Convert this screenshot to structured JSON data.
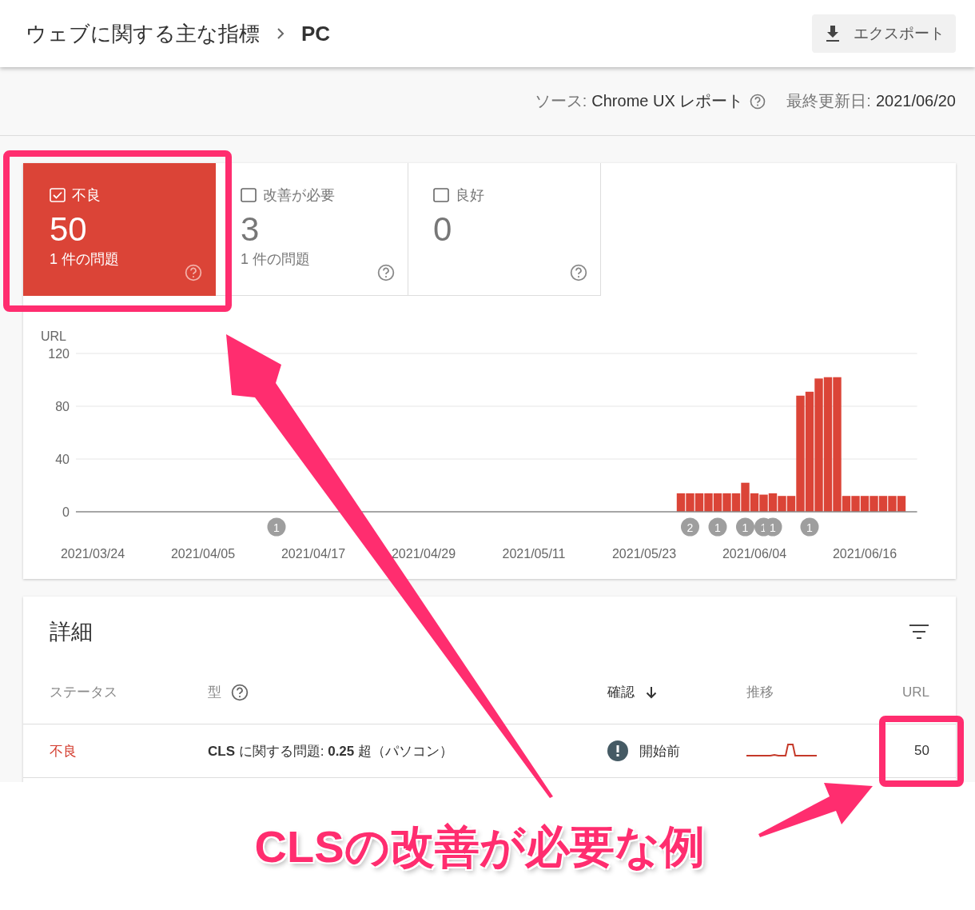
{
  "header": {
    "breadcrumb": [
      {
        "label": "ウェブに関する主な指標"
      },
      {
        "label": "PC"
      }
    ],
    "export_button": "エクスポート"
  },
  "info": {
    "source_label": "ソース:",
    "source": "Chrome UX レポート",
    "updated_label": "最終更新日:",
    "updated": "2021/06/20"
  },
  "tiles": [
    {
      "label": "不良",
      "count": "50",
      "issues": "1 件の問題",
      "checked": true,
      "selected": true
    },
    {
      "label": "改善が必要",
      "count": "3",
      "issues": "1 件の問題",
      "checked": false,
      "selected": false
    },
    {
      "label": "良好",
      "count": "0",
      "checked": false,
      "selected": false
    }
  ],
  "chart": {
    "chart_data": {
      "type": "bar",
      "ylabel": "URL",
      "ylim": [
        0,
        120
      ],
      "yticks": [
        0,
        40,
        80,
        120
      ],
      "categories": [
        "2021/03/24",
        null,
        null,
        null,
        null,
        null,
        null,
        null,
        null,
        null,
        null,
        null,
        "2021/04/05",
        null,
        null,
        null,
        null,
        null,
        null,
        null,
        null,
        null,
        null,
        null,
        "2021/04/17",
        null,
        null,
        null,
        null,
        null,
        null,
        null,
        null,
        null,
        null,
        null,
        "2021/04/29",
        null,
        null,
        null,
        null,
        null,
        null,
        null,
        null,
        null,
        null,
        null,
        "2021/05/11",
        null,
        null,
        null,
        null,
        null,
        null,
        null,
        null,
        null,
        null,
        null,
        "2021/05/23",
        null,
        null,
        null,
        null,
        null,
        null,
        null,
        null,
        null,
        null,
        null,
        "2021/06/04",
        null,
        null,
        null,
        null,
        null,
        null,
        null,
        null,
        null,
        null,
        null,
        "2021/06/16",
        null,
        null,
        null,
        null
      ],
      "series": [
        {
          "color": "#db4437",
          "values": [
            null,
            null,
            null,
            null,
            null,
            null,
            null,
            null,
            null,
            null,
            null,
            null,
            null,
            null,
            null,
            null,
            null,
            null,
            null,
            null,
            null,
            null,
            null,
            null,
            null,
            null,
            null,
            null,
            null,
            null,
            null,
            null,
            null,
            null,
            null,
            null,
            null,
            null,
            null,
            null,
            null,
            null,
            null,
            null,
            null,
            null,
            null,
            null,
            null,
            null,
            null,
            null,
            null,
            null,
            null,
            null,
            null,
            null,
            null,
            null,
            null,
            null,
            null,
            null,
            14,
            14,
            14,
            14,
            14,
            14,
            14,
            22,
            14,
            13,
            14,
            12,
            12,
            88,
            91,
            101,
            102,
            102,
            12,
            12,
            12,
            12,
            12,
            12,
            12
          ]
        }
      ],
      "annotations": [
        "1",
        "2",
        "1",
        "1",
        "1",
        "1",
        "1"
      ]
    }
  },
  "details": {
    "title": "詳細",
    "columns": [
      {
        "label": "ステータス",
        "kind": "plain"
      },
      {
        "label": "型",
        "kind": "help"
      },
      {
        "label": "確認",
        "kind": "sorted"
      },
      {
        "label": "推移",
        "kind": "plain"
      },
      {
        "label": "URL",
        "kind": "plain"
      }
    ],
    "rows": [
      {
        "status": "不良",
        "type": "**CLS** に関する問題: **0.25** 超（パソコン）",
        "validation": "開始前",
        "urls": "50"
      }
    ]
  },
  "annotation": {
    "caption": "CLSの改善が必要な例"
  }
}
